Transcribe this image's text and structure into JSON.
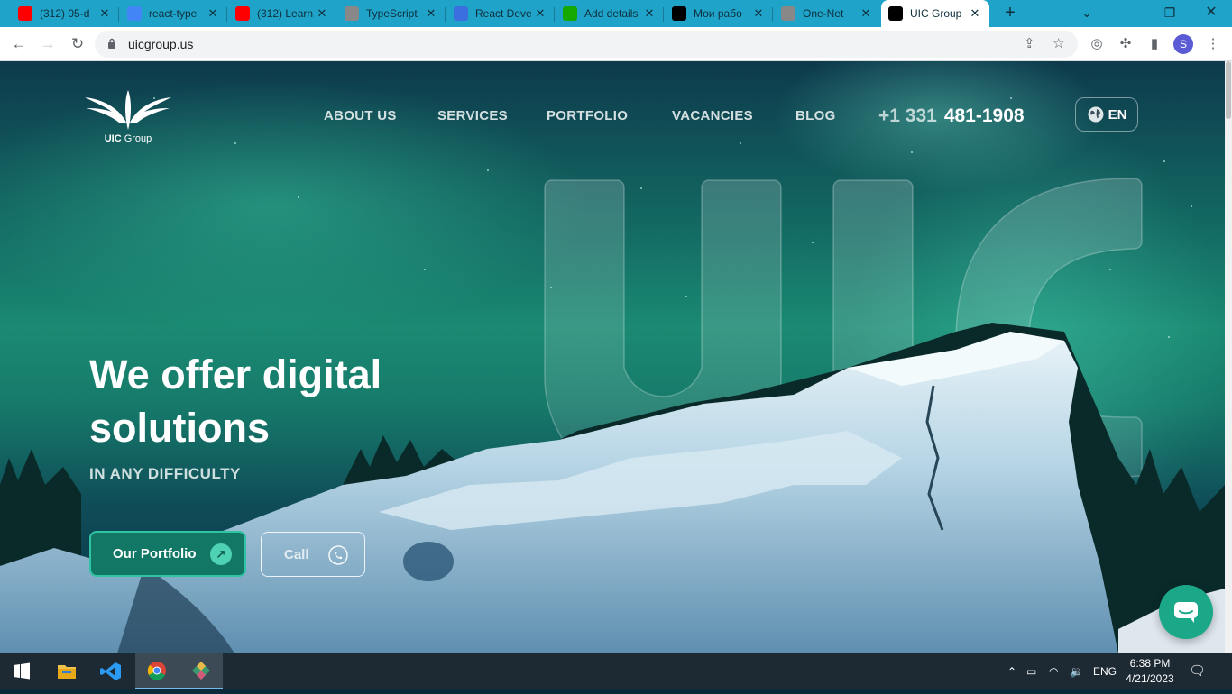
{
  "browser": {
    "tabs": [
      {
        "title": "(312) 05-d",
        "icon": "youtube-icon",
        "color": "#ff0000"
      },
      {
        "title": "react-type",
        "icon": "google-icon",
        "color": "#4285f4"
      },
      {
        "title": "(312) Learn",
        "icon": "youtube-icon",
        "color": "#ff0000"
      },
      {
        "title": "TypeScript",
        "icon": "globe-icon",
        "color": "#888888"
      },
      {
        "title": "React Deve",
        "icon": "oa-icon",
        "color": "#3b6fe0"
      },
      {
        "title": "Add details",
        "icon": "upwork-icon",
        "color": "#14a800"
      },
      {
        "title": "Мои рабо",
        "icon": "k-icon",
        "color": "#000000"
      },
      {
        "title": "One-Net",
        "icon": "page-icon",
        "color": "#888888"
      },
      {
        "title": "UIC Group",
        "icon": "uic-icon",
        "color": "#000000"
      }
    ],
    "new_tab": "+",
    "url": "uicgroup.us"
  },
  "site": {
    "brand": {
      "name_bold": "UIC",
      "name_rest": " Group"
    },
    "nav": [
      "ABOUT US",
      "SERVICES",
      "PORTFOLIO",
      "VACANCIES",
      "BLOG"
    ],
    "phone_prefix": "+1 331",
    "phone_number": "481-1908",
    "language": "EN",
    "hero": {
      "title": "We offer digital solutions",
      "subtitle": "IN ANY DIFFICULTY",
      "portfolio_button": "Our Portfolio",
      "call_button": "Call"
    },
    "accent_color": "#1aa889"
  },
  "taskbar": {
    "apps": [
      "windows-start-icon",
      "file-explorer-icon",
      "vscode-icon",
      "chrome-icon",
      "git-kraken-icon"
    ],
    "language": "ENG",
    "time": "6:38 PM",
    "date": "4/21/2023"
  }
}
